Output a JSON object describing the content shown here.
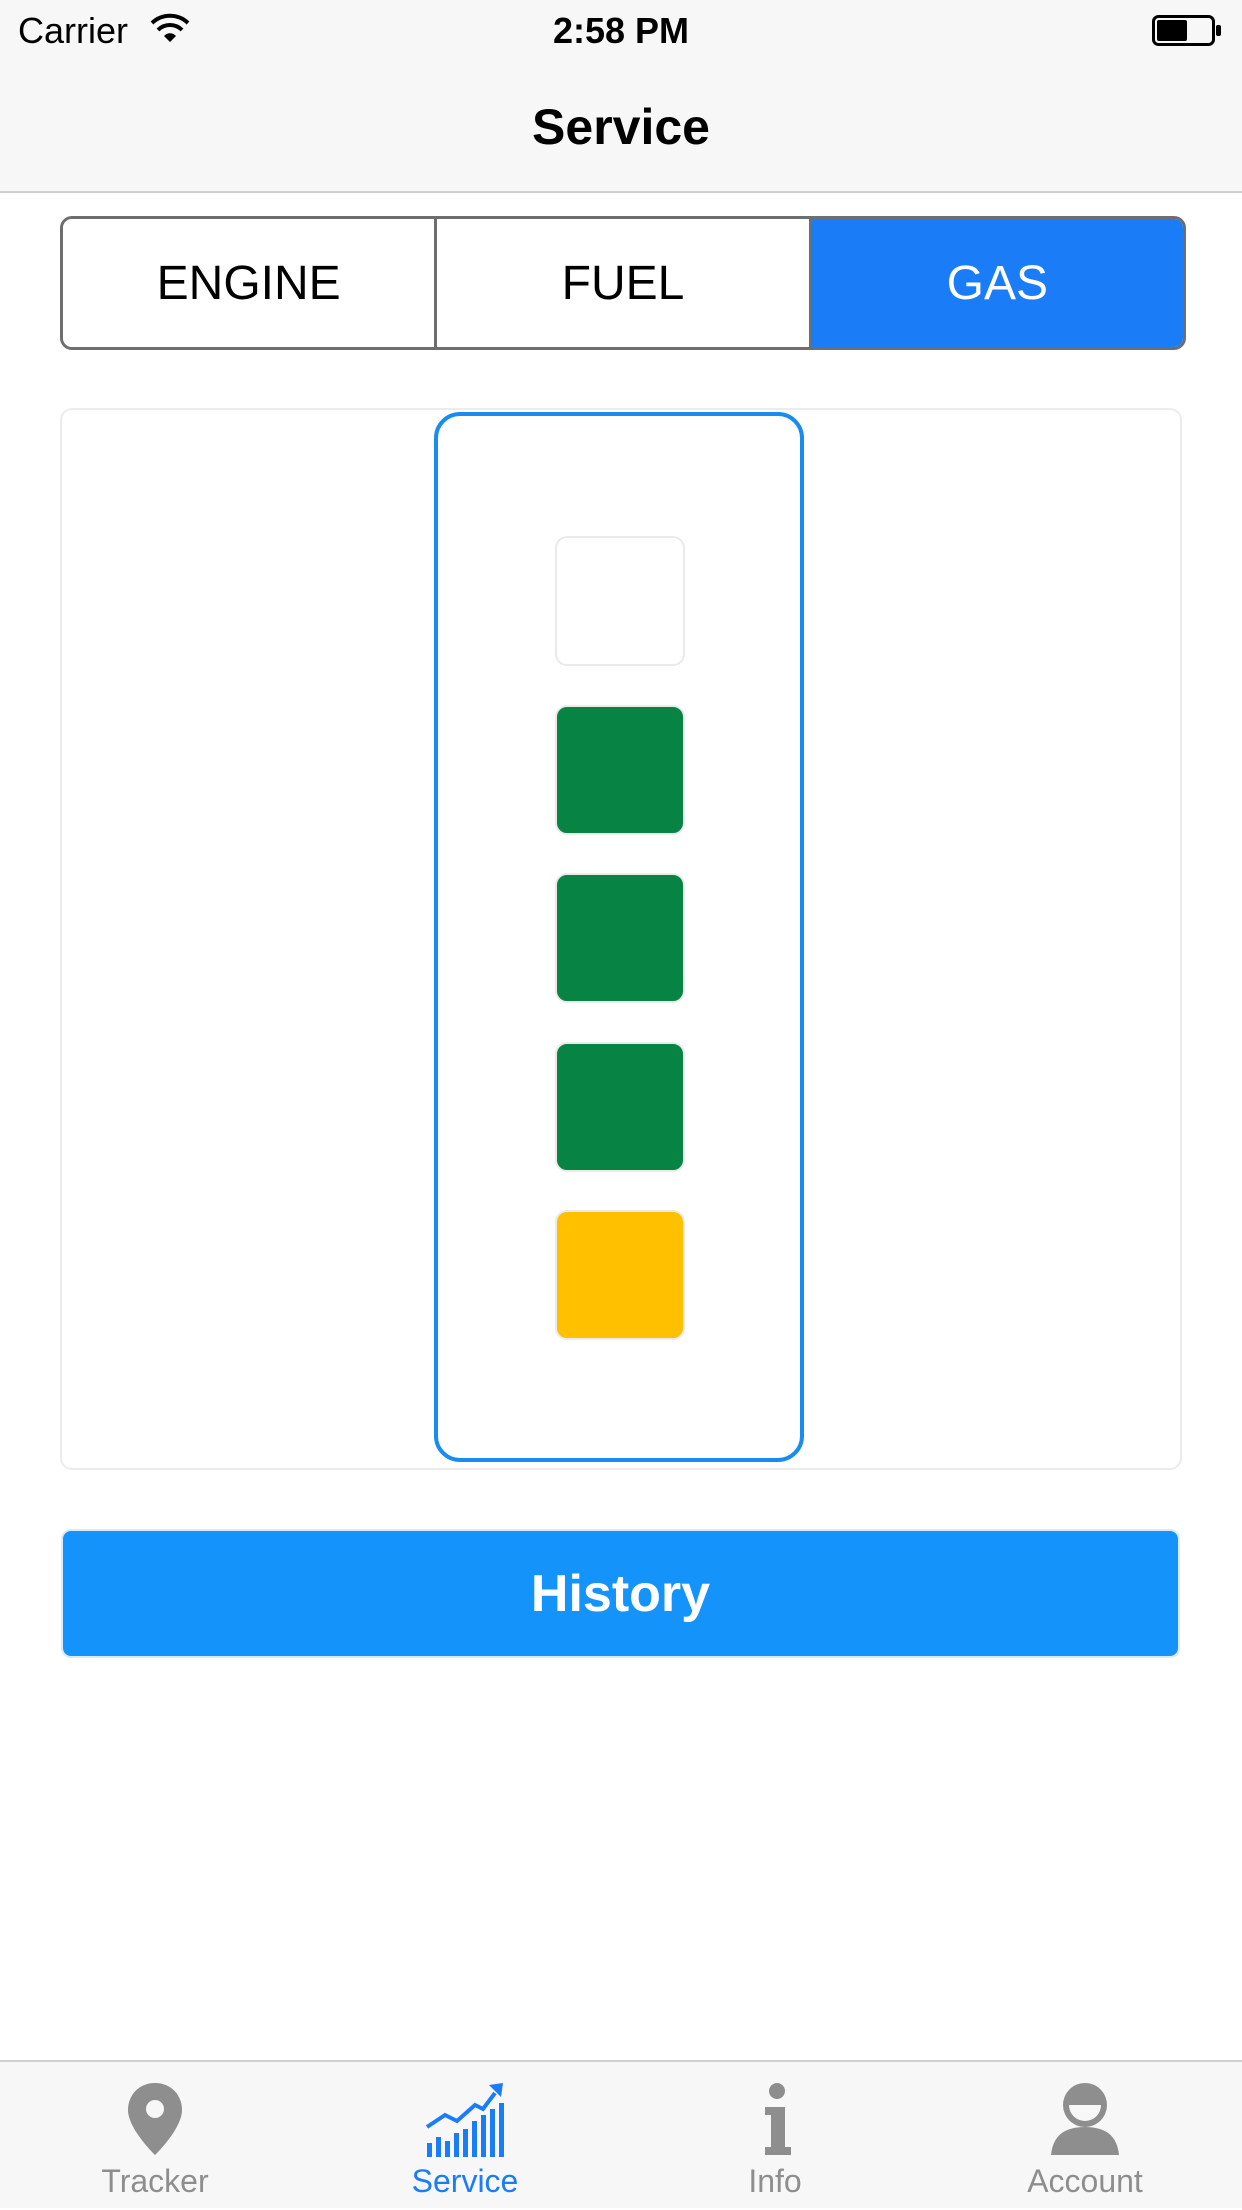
{
  "status_bar": {
    "carrier": "Carrier",
    "time": "2:58 PM",
    "icons": [
      "wifi-icon",
      "battery-icon"
    ]
  },
  "nav": {
    "title": "Service"
  },
  "segments": [
    {
      "label": "ENGINE",
      "active": false
    },
    {
      "label": "FUEL",
      "active": false
    },
    {
      "label": "GAS",
      "active": true
    }
  ],
  "gauge": {
    "levels": [
      {
        "state": "empty",
        "color": "#ffffff"
      },
      {
        "state": "ok",
        "color": "#078444"
      },
      {
        "state": "ok",
        "color": "#078444"
      },
      {
        "state": "ok",
        "color": "#078444"
      },
      {
        "state": "warning",
        "color": "#ffc000"
      }
    ],
    "accent_color": "#1a8cf0"
  },
  "history_button": {
    "label": "History",
    "color": "#1493fb"
  },
  "tabs": [
    {
      "label": "Tracker",
      "icon": "location-pin-icon",
      "active": false
    },
    {
      "label": "Service",
      "icon": "bar-chart-trend-icon",
      "active": true
    },
    {
      "label": "Info",
      "icon": "info-icon",
      "active": false
    },
    {
      "label": "Account",
      "icon": "user-icon",
      "active": false
    }
  ],
  "colors": {
    "accent": "#1a7cf7",
    "inactive_tab": "#8e8e8e"
  }
}
